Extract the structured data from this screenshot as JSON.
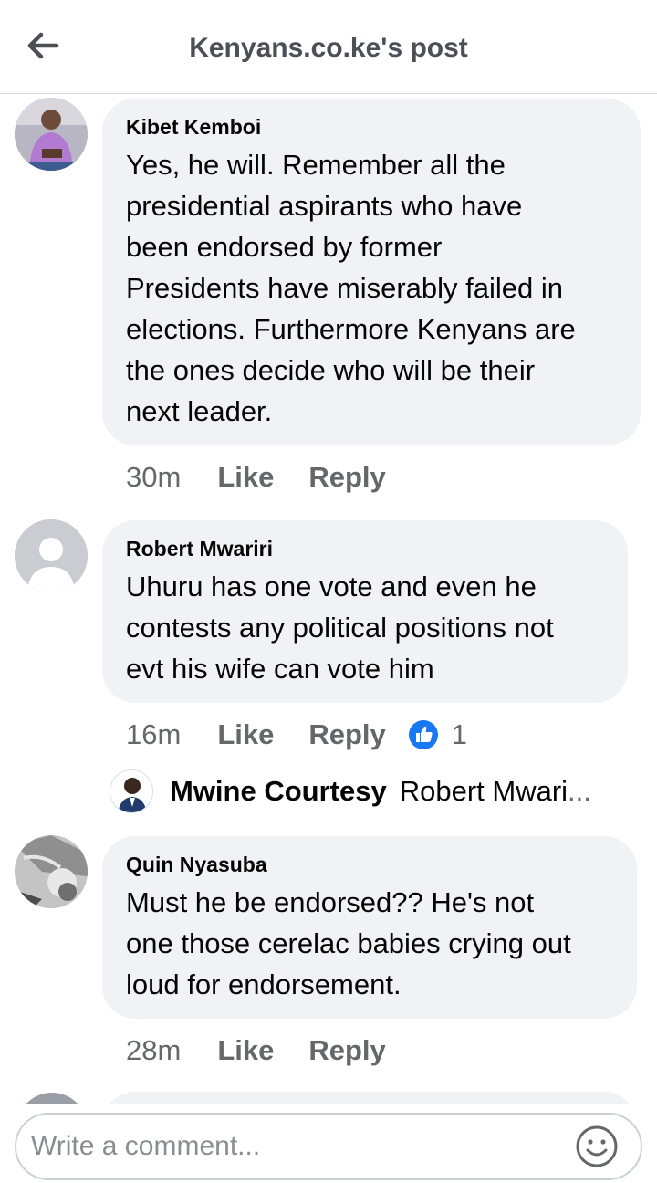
{
  "header": {
    "title": "Kenyans.co.ke's post",
    "back_icon": "arrow-left-icon"
  },
  "comments": [
    {
      "author": "Kibet Kemboi",
      "text_lines": [
        "Yes, he will. Remember all the",
        "presidential aspirants who have",
        "been endorsed by former",
        "Presidents have miserably failed in",
        "elections. Furthermore Kenyans are",
        "the ones decide who will be their",
        "next leader."
      ],
      "time": "30m",
      "like_label": "Like",
      "reply_label": "Reply"
    },
    {
      "author": "Robert Mwariri",
      "text_lines": [
        "Uhuru has one vote and even he",
        "contests any political positions not",
        "evt his wife can vote him"
      ],
      "time": "16m",
      "like_label": "Like",
      "reply_label": "Reply",
      "reaction": {
        "icon": "thumbs-up-icon",
        "count": "1",
        "color": "#1877f2"
      },
      "reply_preview": {
        "name": "Mwine Courtesy",
        "snippet": "Robert Mwari",
        "ellipsis": "..."
      }
    },
    {
      "author": "Quin Nyasuba",
      "text_lines": [
        "Must he be endorsed?? He's not",
        "one those cerelac babies crying out",
        "loud for endorsement."
      ],
      "time": "28m",
      "like_label": "Like",
      "reply_label": "Reply"
    }
  ],
  "composer": {
    "placeholder": "Write a comment...",
    "emoji_icon": "smiley-icon"
  },
  "colors": {
    "bubble": "#f0f2f5",
    "meta_text": "#65676b",
    "title_text": "#4b4f56",
    "like_blue": "#1877f2"
  }
}
